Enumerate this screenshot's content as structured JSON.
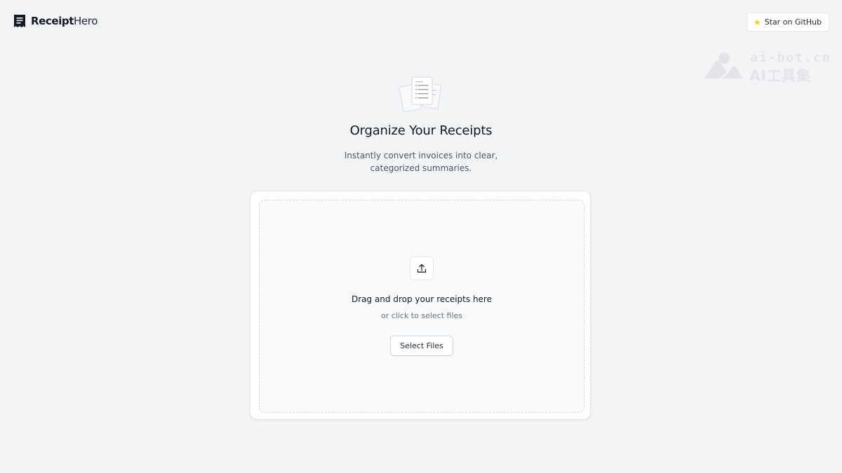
{
  "header": {
    "brand": {
      "name_part1": "Receipt",
      "name_part2": "Hero",
      "icon": "receipt-icon"
    },
    "github_button": {
      "label": "Star on GitHub",
      "icon": "star-icon"
    }
  },
  "watermark": {
    "line1": "ai-bot.cn",
    "line2": "AI工具集"
  },
  "hero": {
    "illustration": "receipts-illustration",
    "title": "Organize Your Receipts",
    "subtitle_line1": "Instantly convert invoices into clear,",
    "subtitle_line2": "categorized summaries."
  },
  "upload": {
    "icon": "upload-icon",
    "title": "Drag and drop your receipts here",
    "subtitle": "or click to select files",
    "button_label": "Select Files"
  },
  "colors": {
    "background": "#f3f4f6",
    "card": "#ffffff",
    "dropzone": "#f9fafb",
    "star": "#facc15",
    "text": "#111827"
  }
}
